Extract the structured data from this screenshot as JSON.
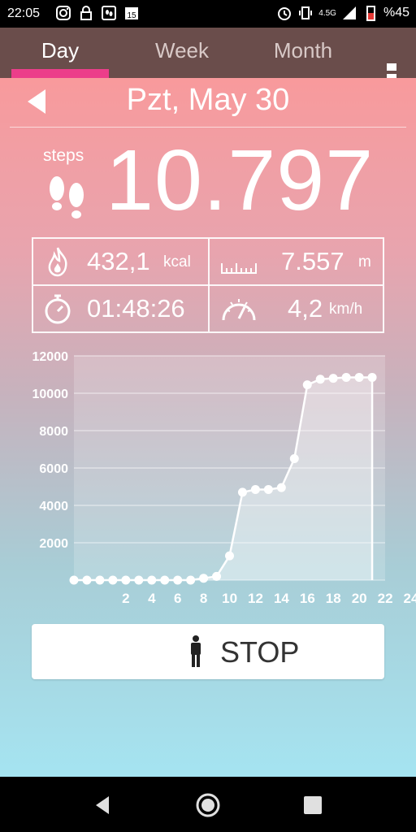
{
  "status": {
    "time": "22:05",
    "network": "4.5G",
    "battery": "%45"
  },
  "tabs": [
    {
      "label": "Day",
      "active": true
    },
    {
      "label": "Week",
      "active": false
    },
    {
      "label": "Month",
      "active": false
    }
  ],
  "day": {
    "date": "Pzt, May 30",
    "steps_label": "steps",
    "steps_value": "10.797"
  },
  "stats": {
    "calories": {
      "value": "432,1",
      "unit": "kcal"
    },
    "distance": {
      "value": "7.557",
      "unit": "m"
    },
    "duration": {
      "value": "01:48:26",
      "unit": ""
    },
    "speed": {
      "value": "4,2",
      "unit": "km/h"
    }
  },
  "stop_button": {
    "label": "STOP"
  },
  "colors": {
    "accent": "#ec3e8a",
    "tabbar": "#6a4d4b",
    "gradient_top": "#f89a9c",
    "gradient_bottom": "#a5e4f1"
  },
  "chart_data": {
    "type": "area",
    "x": [
      0,
      1,
      2,
      3,
      4,
      5,
      6,
      7,
      8,
      9,
      10,
      11,
      12,
      13,
      14,
      15,
      16,
      17,
      18,
      19,
      20,
      21,
      22,
      23
    ],
    "values": [
      0,
      0,
      0,
      0,
      0,
      0,
      0,
      0,
      0,
      0,
      100,
      200,
      1300,
      4700,
      4850,
      4850,
      4950,
      6500,
      10450,
      10750,
      10800,
      10850,
      10850,
      10850
    ],
    "x_ticks": [
      "2",
      "4",
      "6",
      "8",
      "10",
      "12",
      "14",
      "16",
      "18",
      "20",
      "22",
      "24"
    ],
    "y_ticks": [
      "2000",
      "4000",
      "6000",
      "8000",
      "10000",
      "12000"
    ],
    "xlim": [
      0,
      24
    ],
    "ylim": [
      0,
      12000
    ],
    "grid": true
  }
}
